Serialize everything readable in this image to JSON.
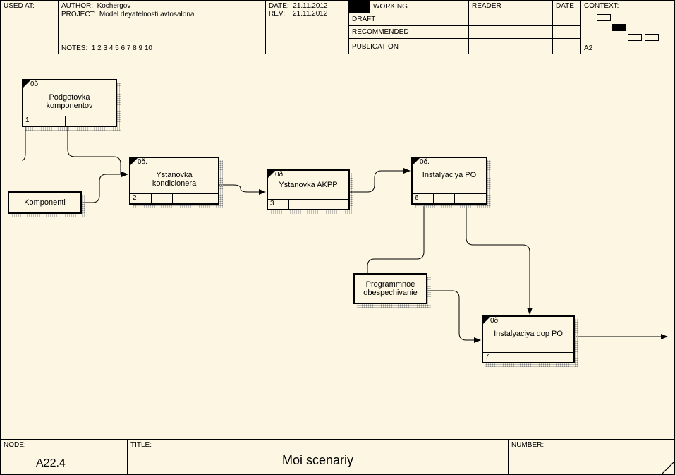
{
  "header": {
    "used_at_label": "USED AT:",
    "author_label": "AUTHOR:",
    "author_value": "Kochergov",
    "project_label": "PROJECT:",
    "project_value": "Model deyatelnosti avtosalona",
    "date_label": "DATE:",
    "date_value": "21.11.2012",
    "rev_label": "REV:",
    "rev_value": "21.11.2012",
    "notes_label": "NOTES:",
    "notes_value": "1  2  3  4  5  6  7  8  9  10",
    "status": {
      "working": "WORKING",
      "draft": "DRAFT",
      "recommended": "RECOMMENDED",
      "publication": "PUBLICATION"
    },
    "reader_label": "READER",
    "reader_date_label": "DATE",
    "context_label": "CONTEXT:",
    "context_code": "A2"
  },
  "blocks": {
    "b1": {
      "id": "0ð.",
      "label": "Podgotovka komponentov",
      "num": "1"
    },
    "b2": {
      "id": "0ð.",
      "label": "Ystanovka kondicionera",
      "num": "2"
    },
    "b3": {
      "id": "0ð.",
      "label": "Ystanovka AKPP",
      "num": "3"
    },
    "b6": {
      "id": "0ð.",
      "label": "Instalyaciya PO",
      "num": "6"
    },
    "b7": {
      "id": "0ð.",
      "label": "Instalyaciya dop PO",
      "num": "7"
    },
    "s1": {
      "label": "Komponenti"
    },
    "s2": {
      "label": "Programmnoe obespechivanie"
    }
  },
  "footer": {
    "node_label": "NODE:",
    "node_value": "A22.4",
    "title_label": "TITLE:",
    "title_value": "Moi scenariy",
    "number_label": "NUMBER:"
  }
}
